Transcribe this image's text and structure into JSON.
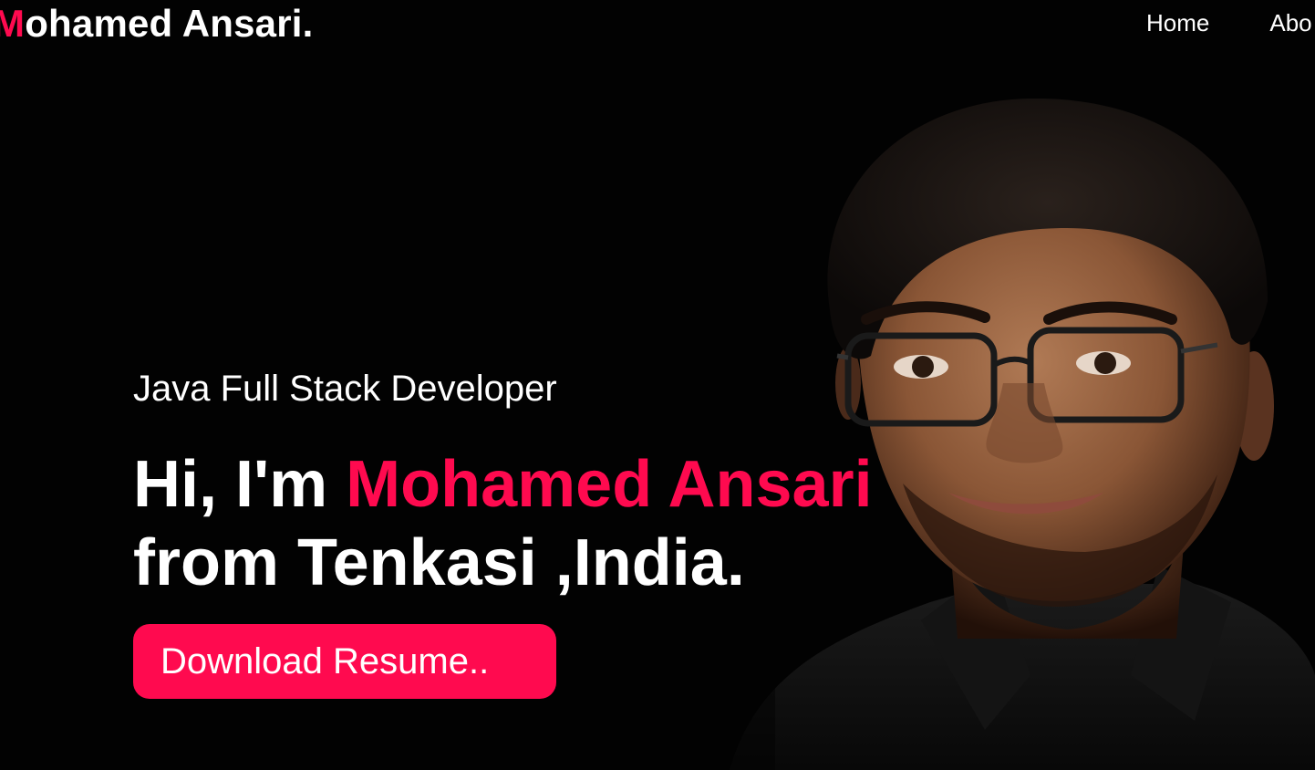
{
  "header": {
    "logo_first_letter": "M",
    "logo_rest": "ohamed Ansari.",
    "nav": {
      "home": "Home",
      "about": "Abo"
    }
  },
  "hero": {
    "subtitle": "Java Full Stack Developer",
    "greeting": "Hi, I'm ",
    "name": "Mohamed Ansari",
    "location": "from Tenkasi ,India.",
    "resume_button": "Download Resume.."
  },
  "colors": {
    "accent": "#ff0a4f",
    "background": "#000000",
    "text": "#ffffff"
  }
}
